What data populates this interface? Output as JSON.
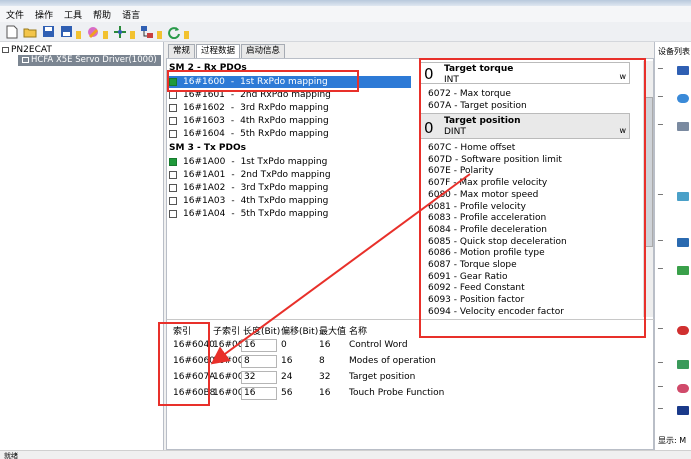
{
  "menu": [
    "文件",
    "操作",
    "工具",
    "帮助",
    "语言"
  ],
  "tree": {
    "root": "PN2ECAT",
    "device": "HCFA X5E Servo Driver(1000)"
  },
  "tabs": [
    "常规",
    "过程数据",
    "启动信息"
  ],
  "sm2": {
    "title": "SM 2 - Rx PDOs",
    "rows": [
      {
        "index": "16#1600",
        "label": "1st RxPdo mapping",
        "checked": true
      },
      {
        "index": "16#1601",
        "label": "2nd RxPdo mapping",
        "checked": false
      },
      {
        "index": "16#1602",
        "label": "3rd RxPdo mapping",
        "checked": false
      },
      {
        "index": "16#1603",
        "label": "4th RxPdo mapping",
        "checked": false
      },
      {
        "index": "16#1604",
        "label": "5th RxPdo mapping",
        "checked": false
      }
    ]
  },
  "sm3": {
    "title": "SM 3 - Tx PDOs",
    "rows": [
      {
        "index": "16#1A00",
        "label": "1st TxPdo mapping",
        "checked": true
      },
      {
        "index": "16#1A01",
        "label": "2nd TxPdo mapping",
        "checked": false
      },
      {
        "index": "16#1A02",
        "label": "3rd TxPdo mapping",
        "checked": false
      },
      {
        "index": "16#1A03",
        "label": "4th TxPdo mapping",
        "checked": false
      },
      {
        "index": "16#1A04",
        "label": "5th TxPdo mapping",
        "checked": false
      }
    ]
  },
  "popup1": {
    "num": "0",
    "title": "Target torque",
    "type": "INT"
  },
  "popup2": {
    "num": "0",
    "title": "Target position",
    "type": "DINT"
  },
  "objects_top": [
    "6072 - Max torque",
    "607A - Target position"
  ],
  "objects": [
    "607C - Home offset",
    "607D - Software position limit",
    "607E - Polarity",
    "607F - Max profile velocity",
    "6080 - Max motor speed",
    "6081 - Profile velocity",
    "6083 - Profile acceleration",
    "6084 - Profile deceleration",
    "6085 - Quick stop deceleration",
    "6086 - Motion profile type",
    "6087 - Torque slope",
    "6091 - Gear Ratio",
    "6092 - Feed Constant",
    "6093 - Position factor",
    "6094 - Velocity encoder factor"
  ],
  "mapping": {
    "headers": [
      "索引",
      "子索引",
      "长度(Bit)",
      "偏移(Bit)",
      "最大值",
      "名称"
    ],
    "rows": [
      {
        "index": "16#6040",
        "sub": "16#00",
        "len": "16",
        "offset": "0",
        "max": "16",
        "name": "Control Word"
      },
      {
        "index": "16#6060",
        "sub": "16#00",
        "len": "8",
        "offset": "16",
        "max": "8",
        "name": "Modes of operation"
      },
      {
        "index": "16#607A",
        "sub": "16#00",
        "len": "32",
        "offset": "24",
        "max": "32",
        "name": "Target position"
      },
      {
        "index": "16#60B8",
        "sub": "16#00",
        "len": "16",
        "offset": "56",
        "max": "16",
        "name": "Touch Probe Function"
      }
    ]
  },
  "right_panel": {
    "title": "设备列表",
    "footer": "显示: M"
  },
  "status": "就绪",
  "colors": {
    "selection": "#2d7ad6",
    "highlight_box": "#e8302a",
    "checked": "#1f9a3b"
  }
}
